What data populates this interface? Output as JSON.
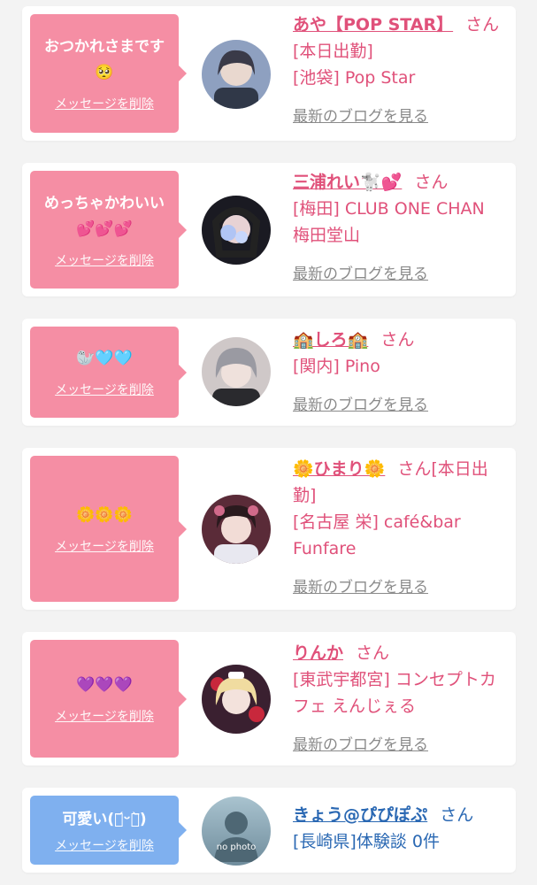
{
  "cards": [
    {
      "message": "おつかれさまです\n🥺",
      "delete_label": "メッセージを削除",
      "name": "あや【POP STAR】",
      "san": "さん",
      "status": "[本日出勤]",
      "shop": "[池袋] Pop Star",
      "blog_link": "最新のブログを見る",
      "theme": "pink"
    },
    {
      "message": "めっちゃかわいい\n💕💕💕",
      "delete_label": "メッセージを削除",
      "name": "三浦れい🐩💕",
      "san": "さん",
      "shop": "[梅田] CLUB ONE CHAN 梅田堂山",
      "blog_link": "最新のブログを見る",
      "theme": "pink"
    },
    {
      "message": "🦭🩵🩵",
      "delete_label": "メッセージを削除",
      "name": "🏫しろ🏫",
      "san": "さん",
      "shop": "[関内] Pino",
      "blog_link": "最新のブログを見る",
      "theme": "pink"
    },
    {
      "message": "🌼🌼🌼",
      "delete_label": "メッセージを削除",
      "name": "🌼ひまり🌼",
      "san": "さん",
      "status": "[本日出勤]",
      "shop": "[名古屋 栄] café&bar Funfare",
      "blog_link": "最新のブログを見る",
      "theme": "pink"
    },
    {
      "message": "💜💜💜",
      "delete_label": "メッセージを削除",
      "name": "りんか",
      "san": "さん",
      "shop": "[東武宇都宮] コンセプトカフェ えんじぇる",
      "blog_link": "最新のブログを見る",
      "theme": "pink"
    },
    {
      "message": "可愛い(･᷄ᵕ･᷅)",
      "delete_label": "メッセージを削除",
      "name": "きょう@ぴぴぽぷ",
      "san": "さん",
      "shop": "[長崎県]体験談 0件",
      "avatar_text": "no photo",
      "theme": "blue"
    }
  ],
  "colors": {
    "pink_bubble": "#f58ea4",
    "blue_bubble": "#7fb0ef",
    "pink_text": "#e0517a",
    "blue_text": "#2a68b3",
    "link_gray": "#8a8a8a"
  }
}
